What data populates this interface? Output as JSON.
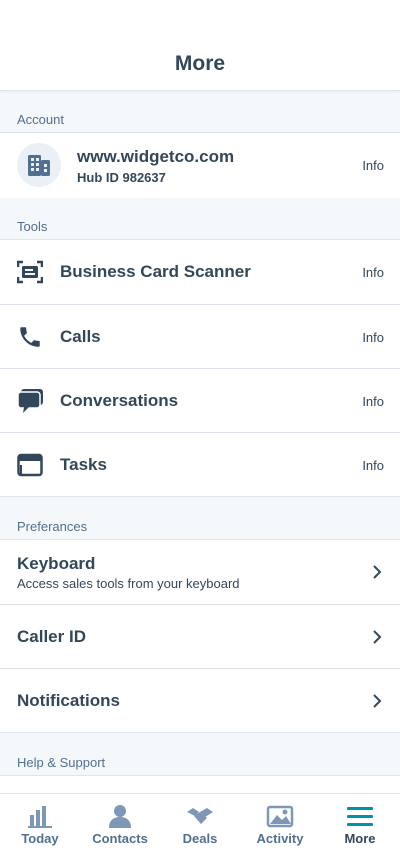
{
  "header": {
    "title": "More"
  },
  "account": {
    "section_label": "Account",
    "domain": "www.widgetco.com",
    "hub_id": "Hub ID 982637",
    "info": "Info",
    "icon": "building-icon"
  },
  "tools": {
    "section_label": "Tools",
    "items": [
      {
        "label": "Business Card Scanner",
        "info": "Info",
        "icon": "card-scanner-icon"
      },
      {
        "label": "Calls",
        "info": "Info",
        "icon": "phone-icon"
      },
      {
        "label": "Conversations",
        "info": "Info",
        "icon": "chat-icon"
      },
      {
        "label": "Tasks",
        "info": "Info",
        "icon": "tasks-icon"
      }
    ]
  },
  "preferences": {
    "section_label": "Preferances",
    "items": [
      {
        "label": "Keyboard",
        "sub": "Access sales tools from your keyboard"
      },
      {
        "label": "Caller ID"
      },
      {
        "label": "Notifications"
      }
    ]
  },
  "help": {
    "section_label": "Help & Support"
  },
  "tabbar": {
    "tabs": [
      {
        "label": "Today",
        "icon": "bar-chart-icon"
      },
      {
        "label": "Contacts",
        "icon": "person-icon"
      },
      {
        "label": "Deals",
        "icon": "handshake-icon"
      },
      {
        "label": "Activity",
        "icon": "activity-icon"
      },
      {
        "label": "More",
        "icon": "menu-icon",
        "active": true
      }
    ]
  },
  "colors": {
    "text": "#33475b",
    "muted": "#516f90",
    "accent": "#0091ae",
    "icon_inactive": "#7c98b6"
  }
}
